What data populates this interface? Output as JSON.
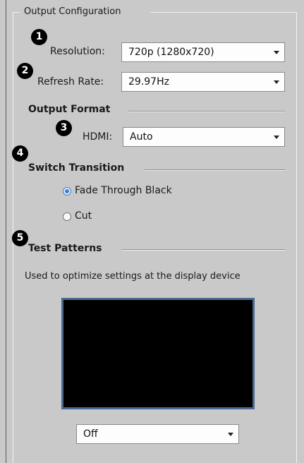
{
  "group": {
    "title": "Output Configuration"
  },
  "badges": [
    "1",
    "2",
    "3",
    "4",
    "5"
  ],
  "resolution": {
    "label": "Resolution:",
    "value": "720p (1280x720)"
  },
  "refresh_rate": {
    "label": "Refresh Rate:",
    "value": "29.97Hz"
  },
  "output_format": {
    "title": "Output Format",
    "hdmi": {
      "label": "HDMI:",
      "value": "Auto"
    }
  },
  "switch_transition": {
    "title": "Switch Transition",
    "options": [
      {
        "label": "Fade Through Black",
        "selected": true
      },
      {
        "label": "Cut",
        "selected": false
      }
    ]
  },
  "test_patterns": {
    "title": "Test Patterns",
    "description": "Used to optimize settings at the display device",
    "select_value": "Off"
  },
  "colors": {
    "accent_radio": "#3b82c8",
    "preview_border": "#4a6a91"
  },
  "icons": {
    "dropdown": "chevron-down-icon"
  }
}
